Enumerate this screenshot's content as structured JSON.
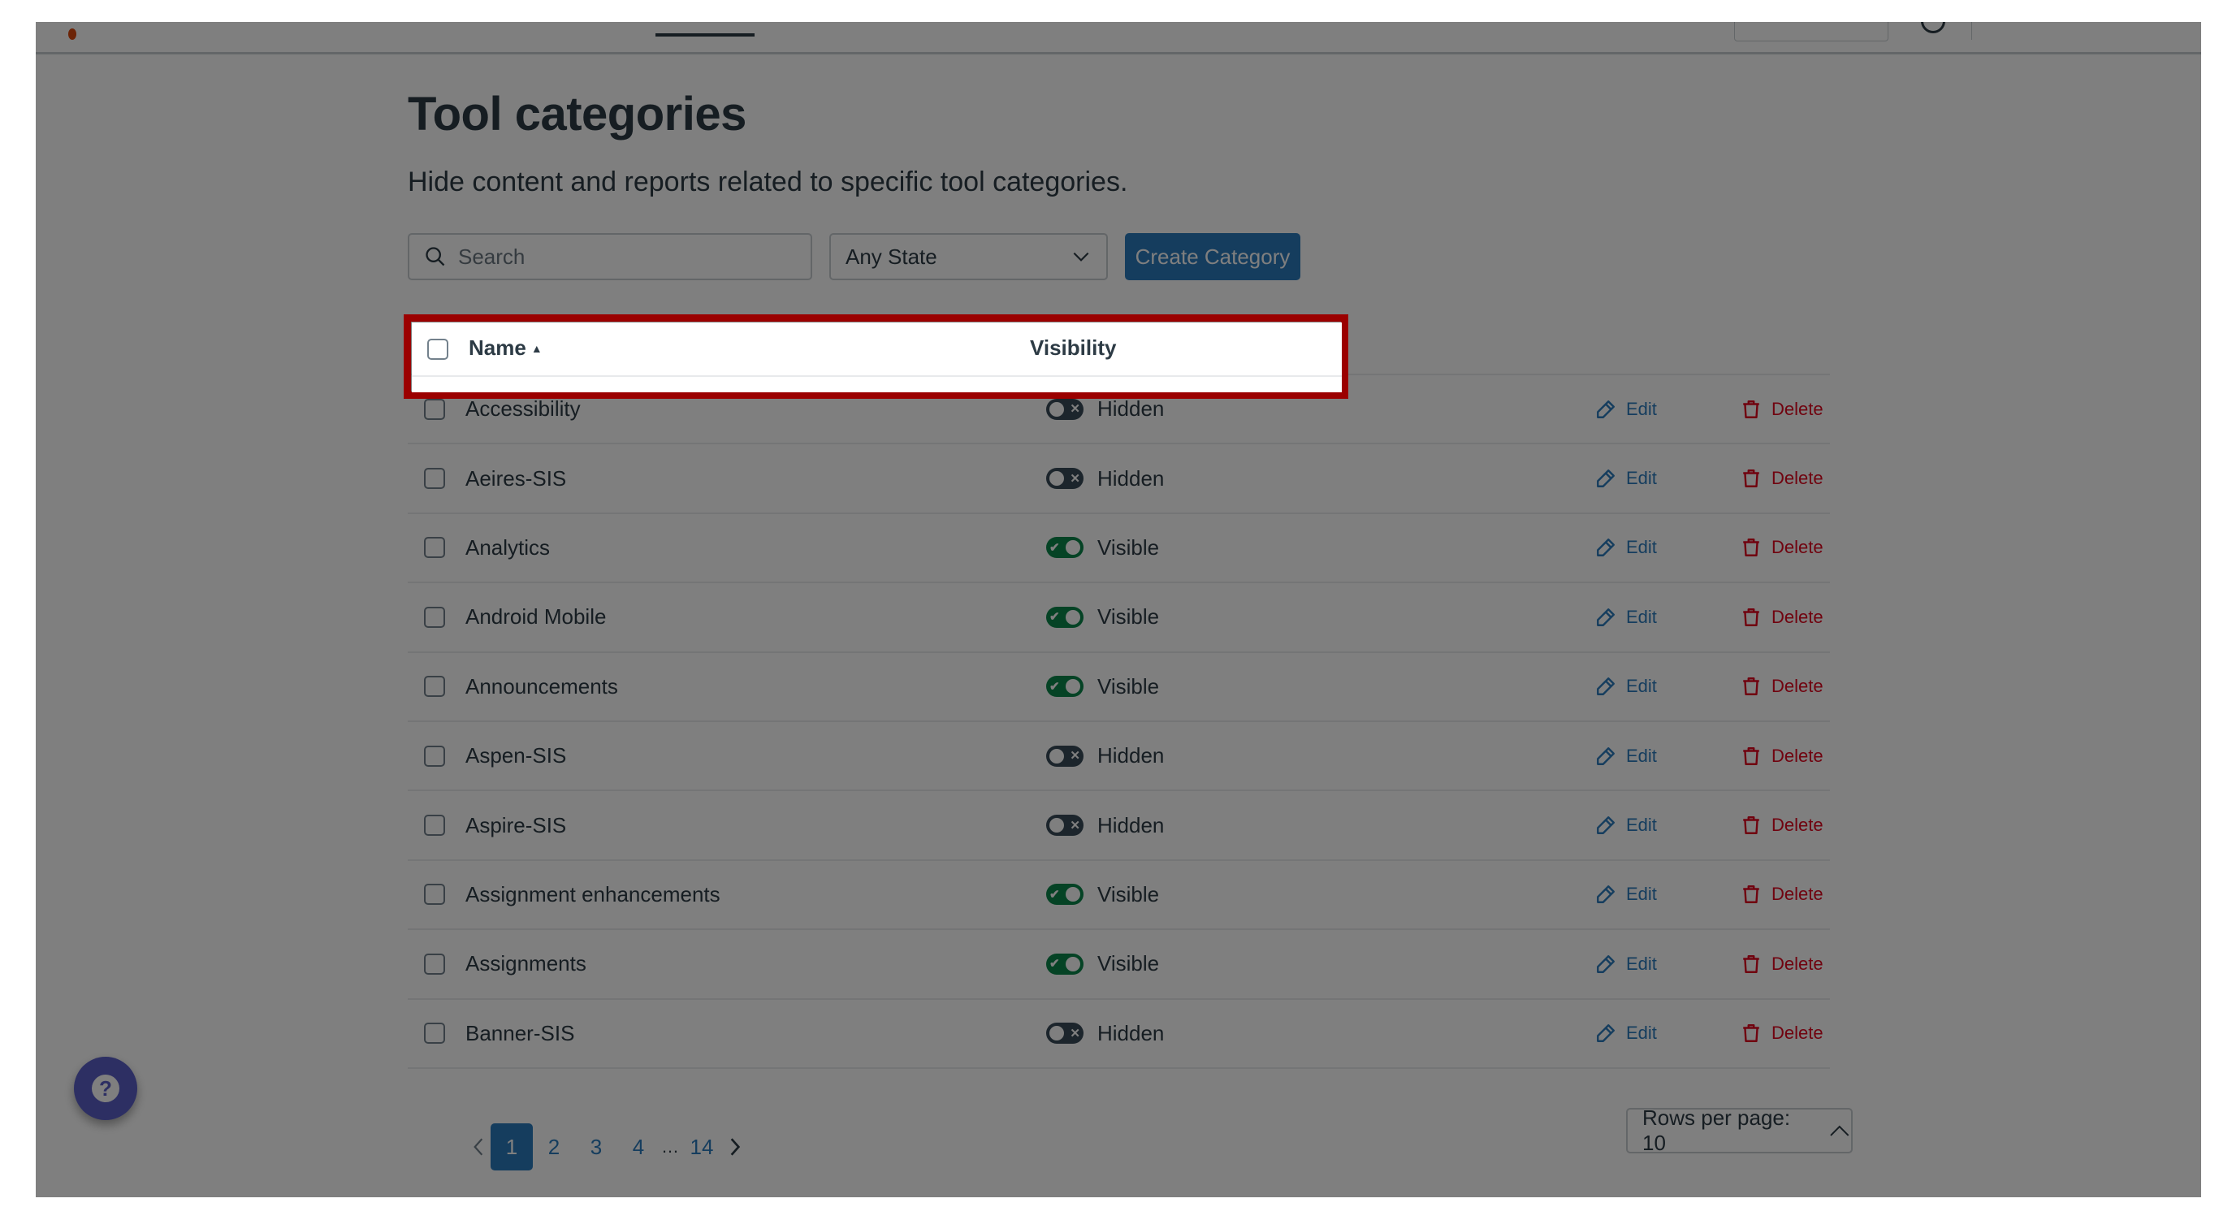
{
  "page": {
    "title": "Tool categories",
    "subtitle": "Hide content and reports related to specific tool categories."
  },
  "toolbar": {
    "search_placeholder": "Search",
    "search_value": "",
    "state_filter": "Any State",
    "create_label": "Create Category"
  },
  "table": {
    "columns": {
      "name": "Name",
      "visibility": "Visibility"
    },
    "sort": {
      "column": "name",
      "direction": "ascending"
    },
    "rows": [
      {
        "name": "Accessibility",
        "visibility": "Hidden",
        "visible": false,
        "edit": "Edit",
        "delete": "Delete"
      },
      {
        "name": "Aeires-SIS",
        "visibility": "Hidden",
        "visible": false,
        "edit": "Edit",
        "delete": "Delete"
      },
      {
        "name": "Analytics",
        "visibility": "Visible",
        "visible": true,
        "edit": "Edit",
        "delete": "Delete"
      },
      {
        "name": "Android Mobile",
        "visibility": "Visible",
        "visible": true,
        "edit": "Edit",
        "delete": "Delete"
      },
      {
        "name": "Announcements",
        "visibility": "Visible",
        "visible": true,
        "edit": "Edit",
        "delete": "Delete"
      },
      {
        "name": "Aspen-SIS",
        "visibility": "Hidden",
        "visible": false,
        "edit": "Edit",
        "delete": "Delete"
      },
      {
        "name": "Aspire-SIS",
        "visibility": "Hidden",
        "visible": false,
        "edit": "Edit",
        "delete": "Delete"
      },
      {
        "name": "Assignment enhancements",
        "visibility": "Visible",
        "visible": true,
        "edit": "Edit",
        "delete": "Delete"
      },
      {
        "name": "Assignments",
        "visibility": "Visible",
        "visible": true,
        "edit": "Edit",
        "delete": "Delete"
      },
      {
        "name": "Banner-SIS",
        "visibility": "Hidden",
        "visible": false,
        "edit": "Edit",
        "delete": "Delete"
      }
    ]
  },
  "pagination": {
    "current": "1",
    "pages": [
      "1",
      "2",
      "3",
      "4"
    ],
    "ellipsis": "…",
    "last": "14"
  },
  "rows_per_page": {
    "label": "Rows per page: 10"
  },
  "colors": {
    "primary": "#2b7abc",
    "danger": "#e0061f",
    "toggle_on": "#0b874b",
    "toggle_off": "#394b58",
    "highlight": "#9b0000",
    "help_button": "#5a5fc7"
  }
}
